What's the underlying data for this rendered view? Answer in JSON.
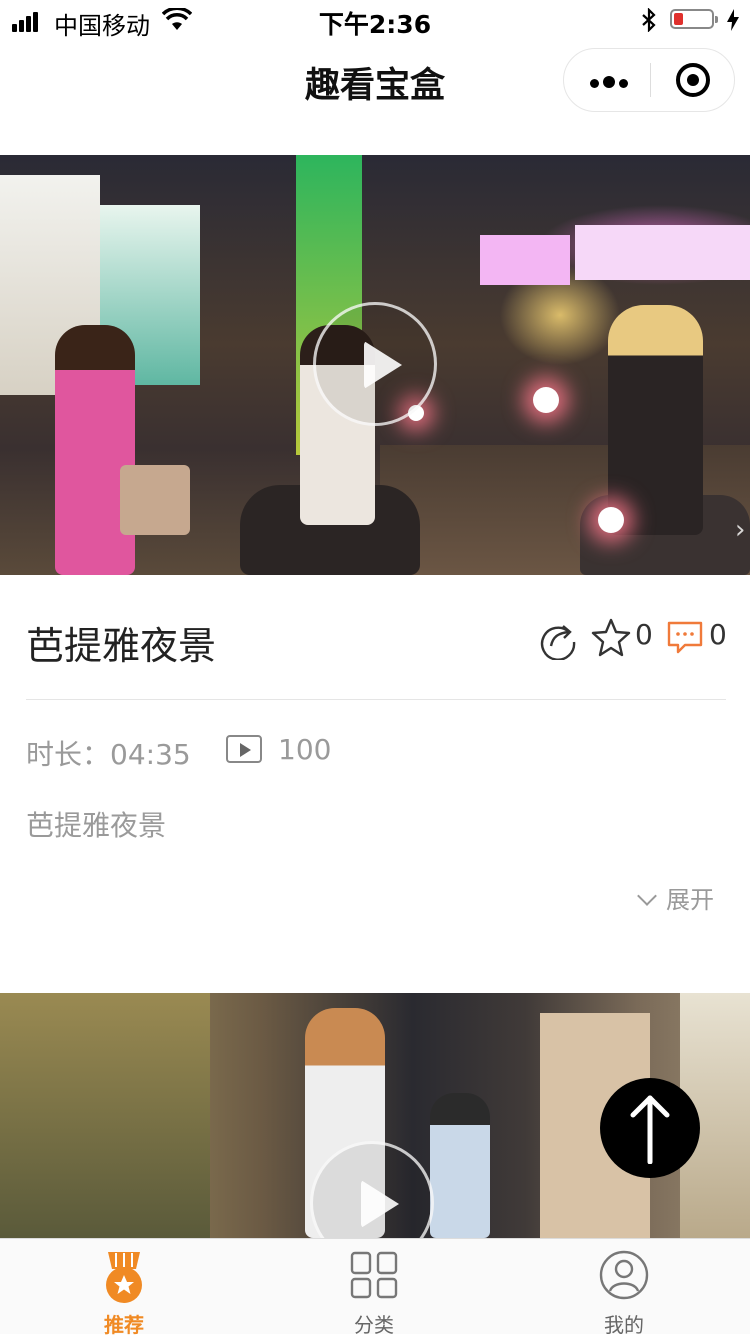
{
  "status_bar": {
    "carrier": "中国移动",
    "time": "下午2:36",
    "battery_color": "#e0302d"
  },
  "nav": {
    "title": "趣看宝盒"
  },
  "video": {
    "title": "芭提雅夜景",
    "star_count": "0",
    "comment_count": "0",
    "duration": "时长：04:35",
    "play_count": "100",
    "description": "芭提雅夜景",
    "expand_label": "展开"
  },
  "tabs": [
    {
      "label": "推荐",
      "icon": "medal-icon",
      "active": true
    },
    {
      "label": "分类",
      "icon": "grid-icon",
      "active": false
    },
    {
      "label": "我的",
      "icon": "user-icon",
      "active": false
    }
  ],
  "colors": {
    "accent": "#f08a24",
    "comment_icon": "#f07a3a",
    "tab_inactive": "#666666"
  }
}
